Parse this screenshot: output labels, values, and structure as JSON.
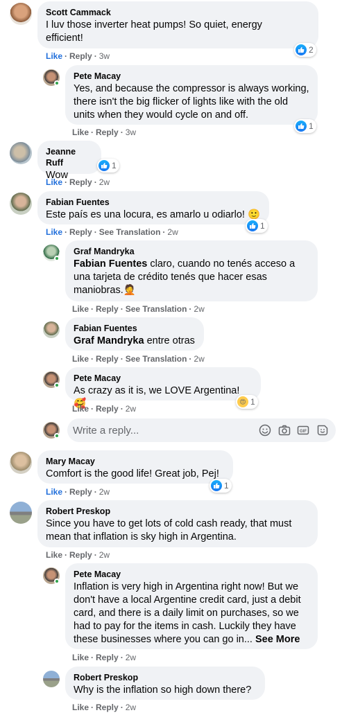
{
  "comments": {
    "c1": {
      "author": "Scott Cammack",
      "text": "I luv those inverter heat pumps! So quiet, energy efficient!",
      "time": "3w",
      "reactions": "2"
    },
    "c2": {
      "author": "Pete Macay",
      "text": "Yes, and because the compressor is always working, there isn't the big flicker of lights like with the old units when they would cycle on and off.",
      "time": "3w",
      "reactions": "1"
    },
    "c3": {
      "author": "Jeanne Ruff",
      "text": "Wow",
      "time": "2w",
      "reactions": "1"
    },
    "c4": {
      "author": "Fabian Fuentes",
      "text": "Este país es una locura, es amarlo u odiarlo! 🙂",
      "time": "2w",
      "reactions": "1"
    },
    "c5": {
      "author": "Graf Mandryka",
      "tag": "Fabian Fuentes",
      "text": " claro, cuando no tenés acceso a una tarjeta de crédito tenés que hacer esas maniobras.🤦",
      "time": "2w"
    },
    "c6": {
      "author": "Fabian Fuentes",
      "tag": "Graf Mandryka",
      "text": " entre otras",
      "time": "2w"
    },
    "c7": {
      "author": "Pete Macay",
      "text": "As crazy as it is, we LOVE Argentina! 🥰",
      "time": "2w",
      "reactions": "1"
    },
    "c8": {
      "author": "Mary Macay",
      "text": "Comfort is the good life! Great job, Pej!",
      "time": "2w",
      "reactions": "1"
    },
    "c9": {
      "author": "Robert Preskop",
      "text": "Since you have to get lots of cold cash ready, that must mean that inflation is sky high in Argentina.",
      "time": "2w"
    },
    "c10": {
      "author": "Pete Macay",
      "text": "Inflation is very high in Argentina right now! But we don't have a local Argentine credit card, just a debit card, and there is a daily limit on purchases, so we had to pay for the items in cash. Luckily they have these businesses where you can go in...",
      "see_more": "See More",
      "time": "2w"
    },
    "c11": {
      "author": "Robert Preskop",
      "text": "Why is the inflation so high down there?",
      "time": "2w"
    }
  },
  "actions": {
    "like": "Like",
    "reply": "Reply",
    "see_translation": "See Translation",
    "sep": "·"
  },
  "reply_box": {
    "placeholder": "Write a reply..."
  },
  "colors": {
    "bubble": "#f0f2f5",
    "action_text": "#65676b",
    "like_blue": "#1877f2",
    "online_green": "#31a24c"
  }
}
